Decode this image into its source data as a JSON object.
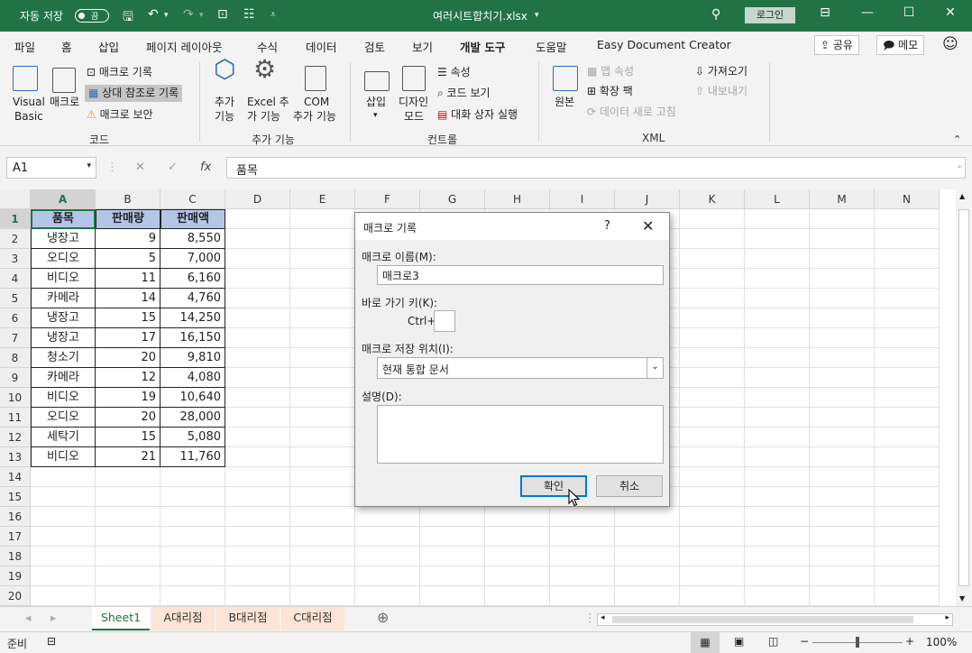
{
  "titlebar": {
    "autosave_label": "자동 저장",
    "autosave_state": "끔",
    "filename": "여러시트합치기.xlsx",
    "login": "로그인"
  },
  "tabs": [
    "파일",
    "홈",
    "삽입",
    "페이지 레이아웃",
    "수식",
    "데이터",
    "검토",
    "보기",
    "개발 도구",
    "도움말",
    "Easy Document Creator"
  ],
  "active_tab": "개발 도구",
  "top_buttons": {
    "share": "공유",
    "memo": "메모"
  },
  "ribbon": {
    "code": {
      "visual_basic_1": "Visual",
      "visual_basic_2": "Basic",
      "macro": "매크로",
      "record_macro": "매크로 기록",
      "relative_ref": "상대 참조로 기록",
      "macro_security": "매크로 보안",
      "group": "코드"
    },
    "addins": {
      "addins_1": "추가",
      "addins_2": "기능",
      "excel_addins_1": "Excel 추",
      "excel_addins_2": "가 기능",
      "com_addins_1": "COM",
      "com_addins_2": "추가 기능",
      "group": "추가 기능"
    },
    "controls": {
      "insert": "삽입",
      "design_1": "디자인",
      "design_2": "모드",
      "properties": "속성",
      "view_code": "코드 보기",
      "run_dialog": "대화 상자 실행",
      "group": "컨트롤"
    },
    "xml": {
      "source": "원본",
      "map_props": "맵 속성",
      "expansion": "확장 팩",
      "refresh": "데이터 새로 고침",
      "import": "가져오기",
      "export": "내보내기",
      "group": "XML"
    }
  },
  "formula_bar": {
    "name_box": "A1",
    "fx": "fx",
    "formula": "품목"
  },
  "columns": [
    "A",
    "B",
    "C",
    "D",
    "E",
    "F",
    "G",
    "H",
    "I",
    "J",
    "K",
    "L",
    "M",
    "N"
  ],
  "rows": [
    "1",
    "2",
    "3",
    "4",
    "5",
    "6",
    "7",
    "8",
    "9",
    "10",
    "11",
    "12",
    "13",
    "14",
    "15",
    "16",
    "17",
    "18",
    "19",
    "20"
  ],
  "table": {
    "headers": [
      "품목",
      "판매량",
      "판매액"
    ],
    "rows": [
      [
        "냉장고",
        "9",
        "8,550"
      ],
      [
        "오디오",
        "5",
        "7,000"
      ],
      [
        "비디오",
        "11",
        "6,160"
      ],
      [
        "카메라",
        "14",
        "4,760"
      ],
      [
        "냉장고",
        "15",
        "14,250"
      ],
      [
        "냉장고",
        "17",
        "16,150"
      ],
      [
        "청소기",
        "20",
        "9,810"
      ],
      [
        "카메라",
        "12",
        "4,080"
      ],
      [
        "비디오",
        "19",
        "10,640"
      ],
      [
        "오디오",
        "20",
        "28,000"
      ],
      [
        "세탁기",
        "15",
        "5,080"
      ],
      [
        "비디오",
        "21",
        "11,760"
      ]
    ]
  },
  "sheets": [
    "Sheet1",
    "A대리점",
    "B대리점",
    "C대리점"
  ],
  "status": {
    "ready": "준비",
    "zoom": "100%"
  },
  "dialog": {
    "title": "매크로 기록",
    "help": "?",
    "name_label": "매크로 이름(M):",
    "name_value": "매크로3",
    "shortcut_label": "바로 가기 키(K):",
    "ctrl": "Ctrl+",
    "store_label": "매크로 저장 위치(I):",
    "store_value": "현재 통합 문서",
    "desc_label": "설명(D):",
    "ok": "확인",
    "cancel": "취소"
  },
  "colors": {
    "accent": "#217346",
    "header_fill": "#b4c6e7",
    "tab_peach": "#fce4d6"
  }
}
